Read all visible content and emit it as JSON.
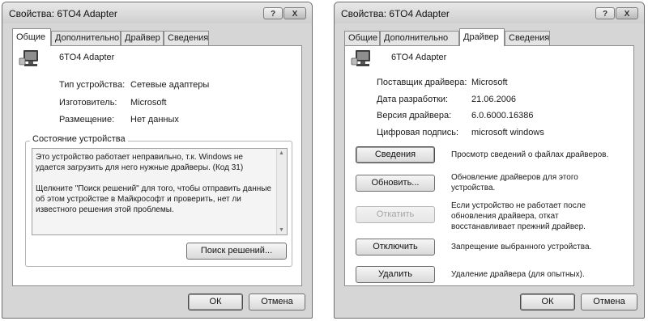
{
  "left": {
    "title": "Свойства: 6TO4 Adapter",
    "tabs": [
      "Общие",
      "Дополнительно",
      "Драйвер",
      "Сведения"
    ],
    "device_name": "6TO4 Adapter",
    "fields": [
      {
        "label": "Тип устройства:",
        "value": "Сетевые адаптеры"
      },
      {
        "label": "Изготовитель:",
        "value": "Microsoft"
      },
      {
        "label": "Размещение:",
        "value": "Нет данных"
      }
    ],
    "status_group_title": "Состояние устройства",
    "status_text_1": "Это устройство работает неправильно, т.к. Windows не удается загрузить для него нужные драйверы. (Код 31)",
    "status_text_2": "Щелкните \"Поиск решений\" для того, чтобы отправить данные об этом устройстве в Майкрософт и проверить, нет ли известного решения этой проблемы.",
    "find_solutions_button": "Поиск решений...",
    "ok_button": "ОК",
    "cancel_button": "Отмена"
  },
  "right": {
    "title": "Свойства: 6TO4 Adapter",
    "tabs": [
      "Общие",
      "Дополнительно",
      "Драйвер",
      "Сведения"
    ],
    "device_name": "6TO4 Adapter",
    "fields": [
      {
        "label": "Поставщик драйвера:",
        "value": "Microsoft"
      },
      {
        "label": "Дата разработки:",
        "value": "21.06.2006"
      },
      {
        "label": "Версия драйвера:",
        "value": "6.0.6000.16386"
      },
      {
        "label": "Цифровая подпись:",
        "value": "microsoft windows"
      }
    ],
    "actions": [
      {
        "button": "Сведения",
        "desc": "Просмотр сведений о файлах драйверов."
      },
      {
        "button": "Обновить...",
        "desc": "Обновление драйверов для этого устройства."
      },
      {
        "button": "Откатить",
        "desc": "Если устройство не работает после обновления драйвера, откат восстанавливает прежний драйвер."
      },
      {
        "button": "Отключить",
        "desc": "Запрещение выбранного устройства."
      },
      {
        "button": "Удалить",
        "desc": "Удаление драйвера (для опытных)."
      }
    ],
    "ok_button": "ОК",
    "cancel_button": "Отмена"
  },
  "icons": {
    "help": "?",
    "close": "X"
  }
}
